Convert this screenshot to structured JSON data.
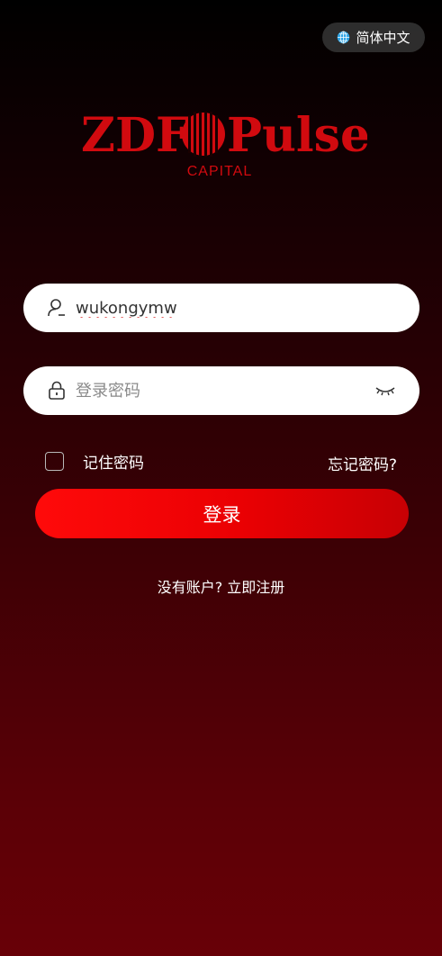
{
  "language": {
    "label": "简体中文",
    "icon": "globe-icon"
  },
  "logo": {
    "left_text": "ZDF",
    "right_text": "Pulse",
    "sub_text": "CAPITAL",
    "color": "#d10a0f"
  },
  "login": {
    "username_value": "wukongymw",
    "password_placeholder": "登录密码",
    "remember_label": "记住密码",
    "forgot_label": "忘记密码?",
    "submit_label": "登录",
    "no_account_label": "没有账户?",
    "register_label": "立即注册"
  },
  "colors": {
    "accent": "#ea0003"
  }
}
